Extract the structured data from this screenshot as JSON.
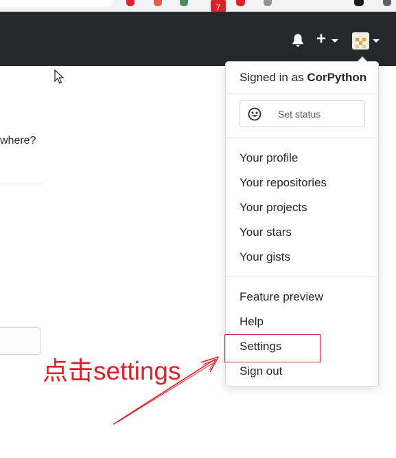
{
  "header": {
    "bell_icon": "bell-icon",
    "new_icon": "plus-icon",
    "caret_icon": "caret-down-icon"
  },
  "page": {
    "partial_text": "where?"
  },
  "menu": {
    "signed_in_prefix": "Signed in as",
    "username": "CorPython",
    "set_status": "Set status",
    "group1": [
      "Your profile",
      "Your repositories",
      "Your projects",
      "Your stars",
      "Your gists"
    ],
    "group2": [
      "Feature preview",
      "Help",
      "Settings",
      "Sign out"
    ]
  },
  "annotation": {
    "hint": "点击settings",
    "color": "#e0202a"
  },
  "browser": {
    "badge": "7"
  }
}
